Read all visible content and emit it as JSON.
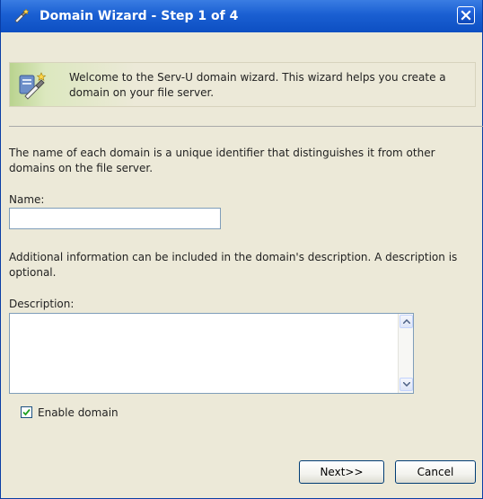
{
  "window": {
    "title": "Domain Wizard - Step 1 of 4",
    "icons": {
      "title": "wizard-icon",
      "close": "close-icon"
    }
  },
  "welcome": {
    "icon": "wizard-icon",
    "text": "Welcome to the Serv-U domain wizard. This wizard helps you create a domain on your file server."
  },
  "form": {
    "intro": "The name of each domain is a unique identifier that distinguishes it from other domains on the file server.",
    "name_label": "Name:",
    "name_value": "",
    "description_info": "Additional information can be included in the domain's description. A description is optional.",
    "description_label": "Description:",
    "description_value": "",
    "enable_label": "Enable domain",
    "enable_checked": true
  },
  "buttons": {
    "next": "Next>>",
    "cancel": "Cancel"
  },
  "colors": {
    "titlebar": "#1a5fd2",
    "dialog_bg": "#ece9d8",
    "banner_accent": "#b9d38f",
    "button_border": "#003c74",
    "checkmark": "#21a121"
  }
}
